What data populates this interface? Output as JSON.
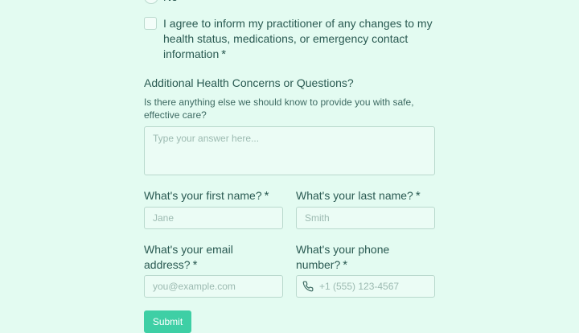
{
  "previous_question": {
    "radio_no_label": "No"
  },
  "consent": {
    "text": "I agree to inform my practitioner of any changes to my health status, medications, or emergency contact information",
    "required_mark": "*"
  },
  "additional": {
    "title": "Additional Health Concerns or Questions?",
    "description": "Is there anything else we should know to provide you with safe, effective care?",
    "placeholder": "Type your answer here..."
  },
  "first_name": {
    "label": "What's your first name?",
    "required_mark": "*",
    "placeholder": "Jane"
  },
  "last_name": {
    "label": "What's your last name?",
    "required_mark": "*",
    "placeholder": "Smith"
  },
  "email": {
    "label": "What's your email address?",
    "required_mark": "*",
    "placeholder": "you@example.com"
  },
  "phone": {
    "label": "What's your phone number?",
    "required_mark": "*",
    "placeholder": "+1 (555) 123-4567",
    "icon": "phone-icon"
  },
  "submit": {
    "label": "Submit"
  },
  "colors": {
    "background": "#e3fbf1",
    "accent": "#3ecfa5",
    "text": "#2a5a52"
  }
}
